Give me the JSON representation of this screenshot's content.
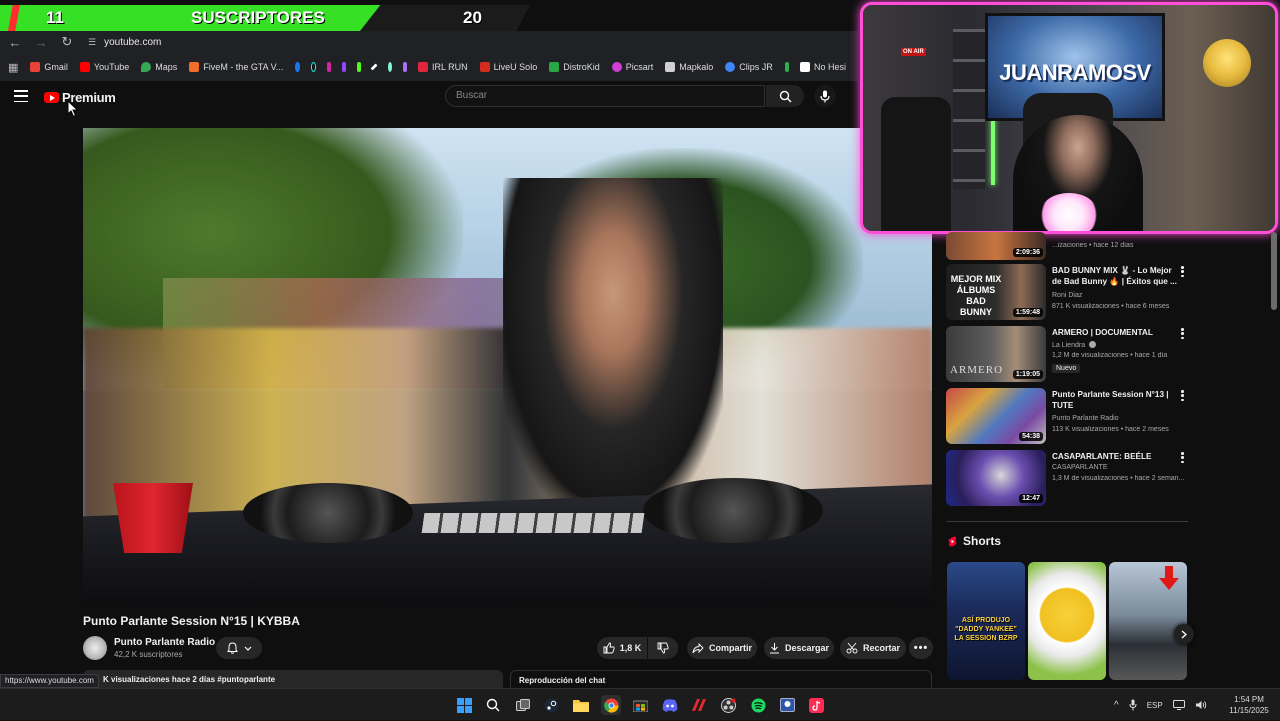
{
  "overlay": {
    "sub_current": "11",
    "sub_label": "SUSCRIPTORES",
    "sub_goal": "20"
  },
  "browser": {
    "url": "youtube.com",
    "bookmarks": [
      {
        "label": "Gmail",
        "color": "#ea4335"
      },
      {
        "label": "YouTube",
        "color": "#ff0000"
      },
      {
        "label": "Maps",
        "color": "#34a853"
      },
      {
        "label": "FiveM - the GTA V...",
        "color": "#f26c2c"
      }
    ],
    "bookmarks2": [
      {
        "label": "IRL RUN",
        "color": "#e0263a"
      },
      {
        "label": "LiveU Solo",
        "color": "#d52b1e"
      },
      {
        "label": "DistroKid",
        "color": "#28a745"
      },
      {
        "label": "Picsart",
        "color": "#d03fd6"
      },
      {
        "label": "Mapkalo",
        "color": "#cfcfcf"
      },
      {
        "label": "Clips JR",
        "color": "#4285f4"
      },
      {
        "label": "No Hesi",
        "color": "#ffffff"
      }
    ],
    "status_url": "https://www.youtube.com"
  },
  "youtube": {
    "logo_text": "Premium",
    "search_placeholder": "Buscar",
    "video": {
      "title": "Punto Parlante Session N°15 | KYBBA",
      "channel": "Punto Parlante Radio",
      "subscribers": "42,2 K suscriptores",
      "likes": "1,8 K",
      "share": "Compartir",
      "download": "Descargar",
      "clip": "Recortar",
      "description_line": "K visualizaciones  hace 2 días  #puntoparlante",
      "chat_replay": "Reproducción del chat"
    },
    "recommendations": [
      {
        "title": "",
        "channel": "",
        "meta": "...izaciones • hace 12 días",
        "duration": "2:09:36",
        "badge": ""
      },
      {
        "title": "BAD BUNNY MIX 🐰 - Lo Mejor de Bad Bunny 🔥 | Éxitos que ...",
        "channel": "Roni Diaz",
        "meta": "871 K visualizaciones • hace 6 meses",
        "duration": "1:59:48",
        "badge": "",
        "thumb_text": "MEJOR MIX ÁLBUMS BAD BUNNY"
      },
      {
        "title": "ARMERO | DOCUMENTAL",
        "channel": "La Liendra",
        "meta": "1,2 M de visualizaciones • hace 1 día",
        "duration": "1:19:05",
        "badge": "Nuevo",
        "thumb_text": "ARMERO"
      },
      {
        "title": "Punto Parlante Session N°13 | TUTE",
        "channel": "Punto Parlante Radio",
        "meta": "113 K visualizaciones • hace 2 meses",
        "duration": "54:38",
        "badge": ""
      },
      {
        "title": "CASAPARLANTE: BEÉLE",
        "channel": "CASAPARLANTE",
        "meta": "1,3 M de visualizaciones • hace 2 seman...",
        "duration": "12:47",
        "badge": ""
      }
    ],
    "shorts_heading": "Shorts",
    "shorts": [
      {
        "text": "ASÍ PRODUJO \"DADDY YANKEE\" LA SESSION BZRP"
      },
      {
        "text": ""
      },
      {
        "text": ""
      }
    ]
  },
  "webcam": {
    "screen_text": "JUANRAMOSV",
    "onair": "ON AIR"
  },
  "taskbar": {
    "lang": "ESP",
    "time": "1:54 PM",
    "date": "11/15/2025"
  },
  "colors": {
    "accent_green": "#35e025",
    "webcam_border": "#ff4fd8",
    "youtube_red": "#ff0000"
  }
}
